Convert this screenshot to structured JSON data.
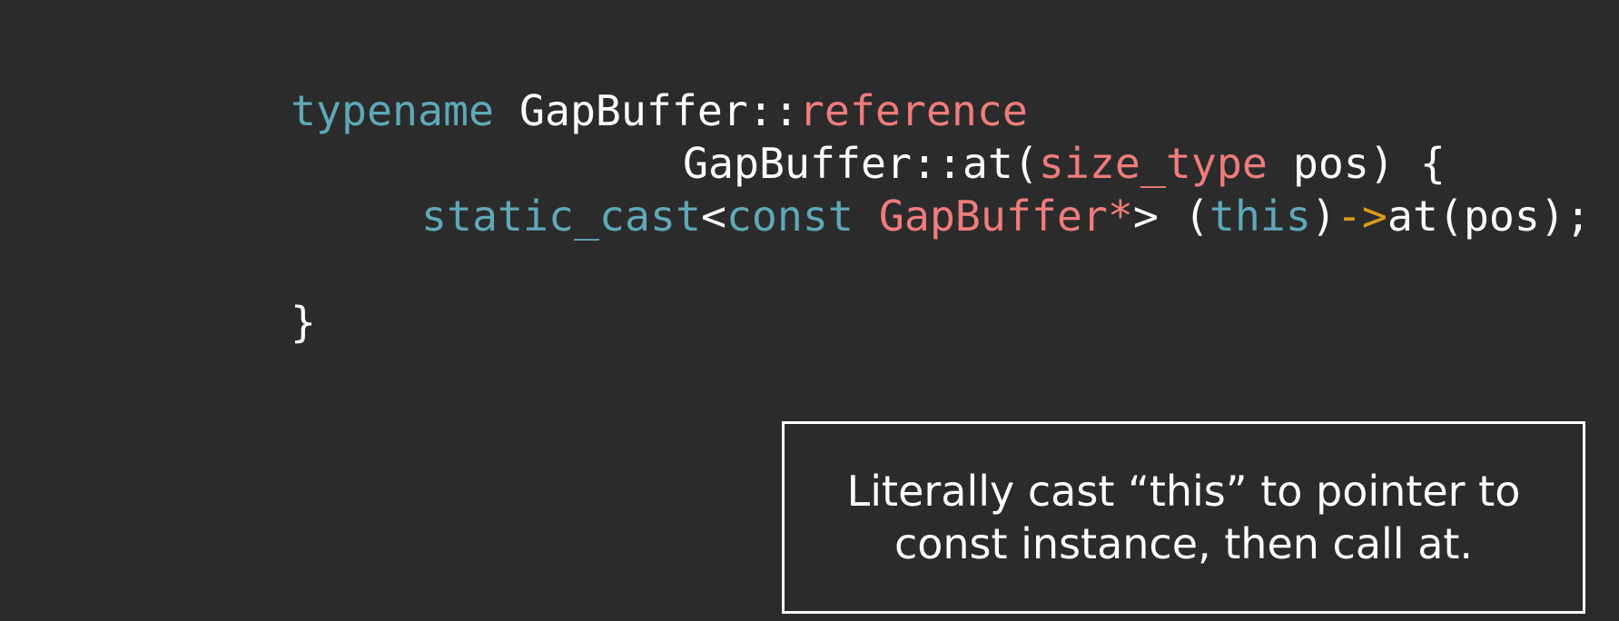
{
  "code": {
    "line1": {
      "t1": "typename",
      "t2": " GapBuffer::",
      "t3": "reference"
    },
    "line2": {
      "t1": "GapBuffer::at(",
      "t2": "size_type",
      "t3": " pos) {"
    },
    "line3": {
      "t1": "static_cast",
      "t2": "<",
      "t3": "const",
      "t4": " ",
      "t5": "GapBuffer*",
      "t6": "> (",
      "t7": "this",
      "t8": ")",
      "t9": "->",
      "t10": "at(pos);"
    },
    "line4": {
      "t1": "}"
    }
  },
  "callout": {
    "text": "Literally cast “this” to pointer to const instance, then call at."
  },
  "colors": {
    "background": "#2b2b2b",
    "keyword": "#5fa8b8",
    "type": "#f07c7c",
    "operator": "#d99a1c",
    "text": "#ffffff"
  }
}
